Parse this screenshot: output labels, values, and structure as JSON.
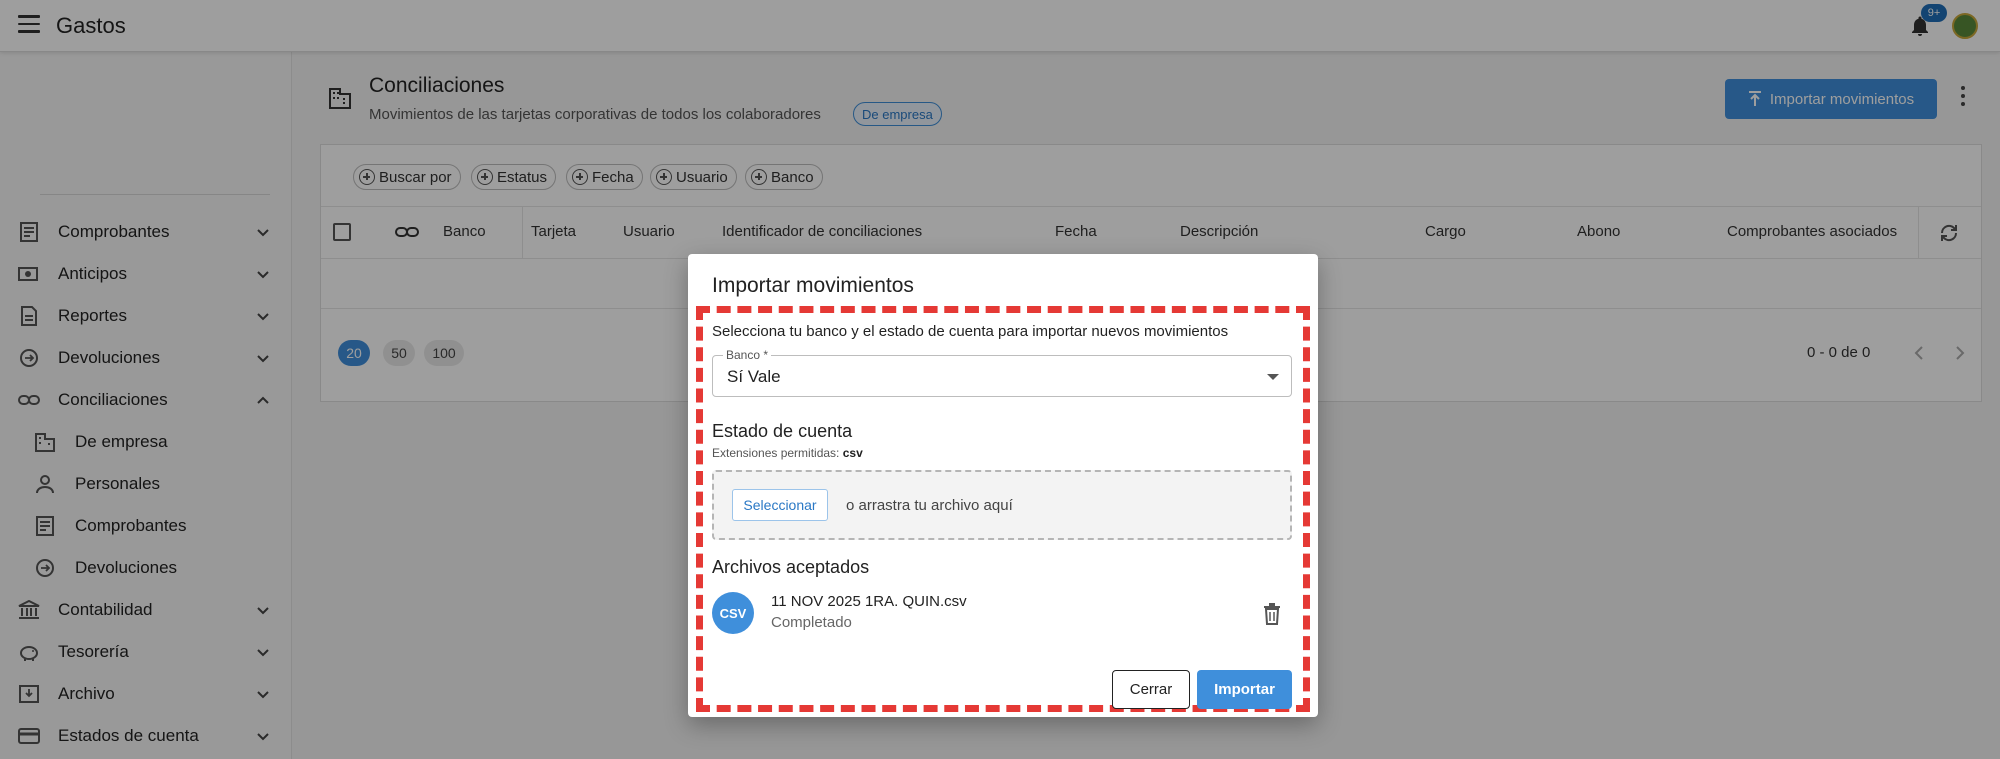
{
  "app": {
    "title": "Gastos",
    "notification_count": "9+"
  },
  "sidebar": {
    "items": [
      {
        "label": "Comprobantes",
        "icon": "receipt-icon",
        "expanded": false
      },
      {
        "label": "Anticipos",
        "icon": "cash-icon",
        "expanded": false
      },
      {
        "label": "Reportes",
        "icon": "report-icon",
        "expanded": false
      },
      {
        "label": "Devoluciones",
        "icon": "refund-icon",
        "expanded": false
      },
      {
        "label": "Conciliaciones",
        "icon": "link-icon",
        "expanded": true
      },
      {
        "label": "Contabilidad",
        "icon": "bank-icon",
        "expanded": false
      },
      {
        "label": "Tesorería",
        "icon": "piggy-bank-icon",
        "expanded": false
      },
      {
        "label": "Archivo",
        "icon": "archive-icon",
        "expanded": false
      },
      {
        "label": "Estados de cuenta",
        "icon": "card-icon",
        "expanded": false
      }
    ],
    "subitems": [
      {
        "label": "De empresa",
        "icon": "building-icon"
      },
      {
        "label": "Personales",
        "icon": "person-icon"
      },
      {
        "label": "Comprobantes",
        "icon": "receipt-icon"
      },
      {
        "label": "Devoluciones",
        "icon": "refund-icon"
      }
    ]
  },
  "page": {
    "title": "Conciliaciones",
    "subtitle": "Movimientos de las tarjetas corporativas de todos los colaboradores",
    "scope_badge": "De empresa",
    "import_button": "Importar movimientos"
  },
  "filters": [
    "Buscar por",
    "Estatus",
    "Fecha",
    "Usuario",
    "Banco"
  ],
  "table": {
    "columns": [
      "Banco",
      "Tarjeta",
      "Usuario",
      "Identificador de conciliaciones",
      "Fecha",
      "Descripción",
      "Cargo",
      "Abono",
      "Comprobantes asociados"
    ]
  },
  "pagination": {
    "sizes": [
      "20",
      "50",
      "100"
    ],
    "active_size": "20",
    "range": "0 - 0 de 0"
  },
  "modal": {
    "title": "Importar movimientos",
    "description": "Selecciona tu banco y el estado de cuenta para importar nuevos movimientos",
    "bank_label": "Banco *",
    "bank_value": "Sí Vale",
    "statement_title": "Estado de cuenta",
    "extensions_label": "Extensiones permitidas:",
    "extensions_value": "csv",
    "select_button": "Seleccionar",
    "drop_text": "o arrastra tu archivo aquí",
    "accepted_title": "Archivos aceptados",
    "file_badge": "CSV",
    "file_name": "11 NOV 2025 1RA. QUIN.csv",
    "file_status": "Completado",
    "close_button": "Cerrar",
    "import_button": "Importar"
  },
  "colors": {
    "primary": "#3f8fdb",
    "highlight": "#e53935"
  }
}
